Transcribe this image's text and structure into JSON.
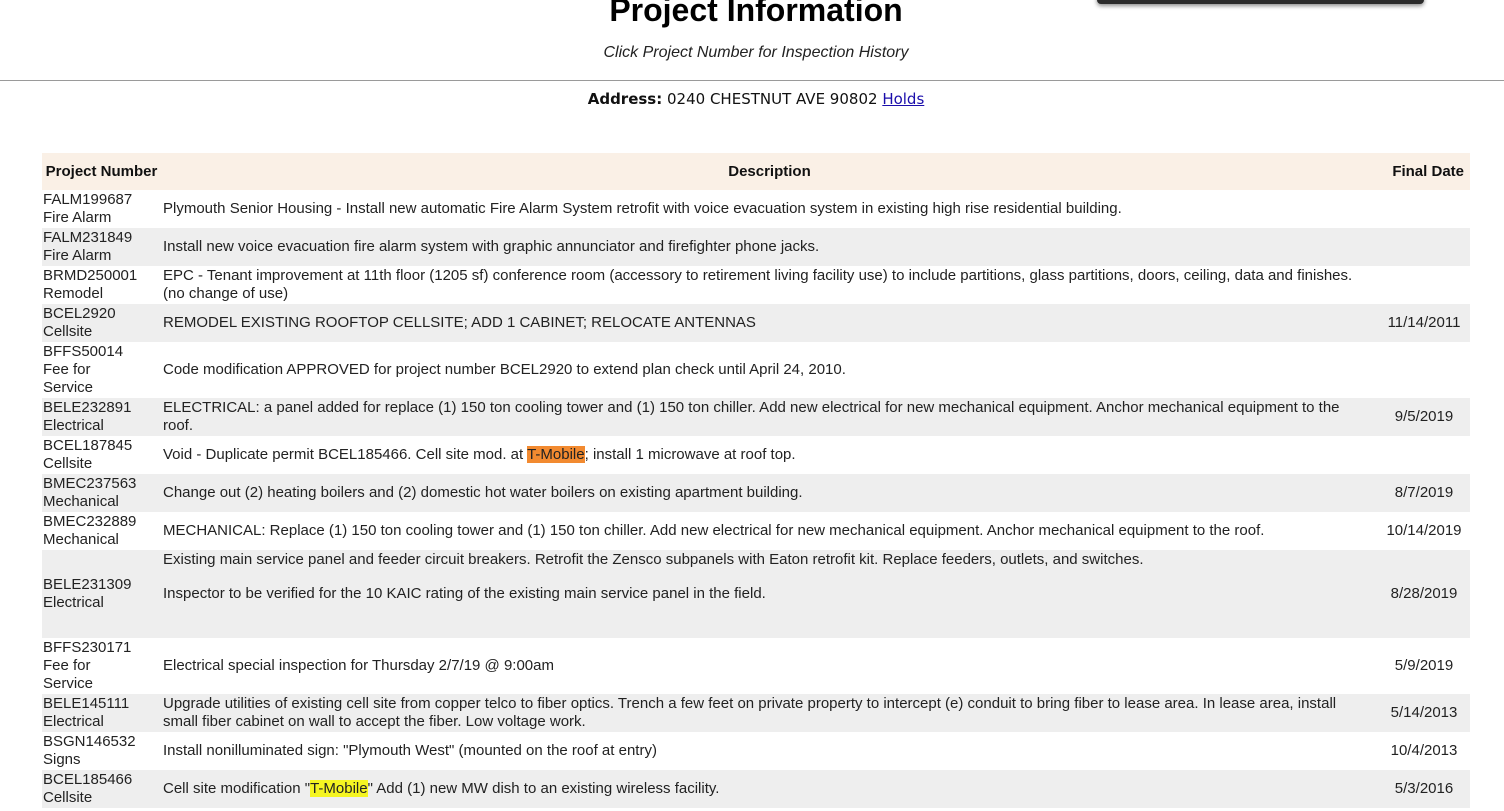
{
  "page": {
    "title": "Project Information",
    "subtitle": "Click Project Number for Inspection History",
    "address_label": "Address:",
    "address_value": "0240 CHESTNUT AVE 90802",
    "holds_link": "Holds"
  },
  "table": {
    "headers": {
      "number": "Project Number",
      "description": "Description",
      "final_date": "Final Date"
    },
    "rows": [
      {
        "id": "FALM199687",
        "type": "Fire Alarm",
        "description": "Plymouth Senior Housing - Install new automatic Fire Alarm System retrofit with voice evacuation system in existing high rise residential building.",
        "date": ""
      },
      {
        "id": "FALM231849",
        "type": "Fire Alarm",
        "description": "Install new voice evacuation fire alarm system with graphic annunciator and firefighter phone jacks.",
        "date": ""
      },
      {
        "id": "BRMD250001",
        "type": "Remodel",
        "description": "EPC - Tenant improvement at 11th floor (1205 sf) conference room (accessory to retirement living facility use) to include partitions, glass partitions, doors, ceiling, data and finishes. (no change of use)",
        "date": ""
      },
      {
        "id": "BCEL2920",
        "type": "Cellsite",
        "description": "REMODEL EXISTING ROOFTOP CELLSITE; ADD 1 CABINET; RELOCATE ANTENNAS",
        "date": "11/14/2011"
      },
      {
        "id": "BFFS50014",
        "type": "Fee for Service",
        "description": "Code modification APPROVED for project number BCEL2920 to extend plan check until April 24, 2010.",
        "date": ""
      },
      {
        "id": "BELE232891",
        "type": "Electrical",
        "description": "ELECTRICAL: a panel added for replace (1) 150 ton cooling tower and (1) 150 ton chiller. Add new electrical for new mechanical equipment. Anchor mechanical equipment to the roof.",
        "date": "9/5/2019"
      },
      {
        "id": "BCEL187845",
        "type": "Cellsite",
        "description_pre": "Void - Duplicate permit BCEL185466.  Cell site mod. at ",
        "highlight": "T-Mobile",
        "description_post": "; install 1 microwave at roof top.",
        "date": ""
      },
      {
        "id": "BMEC237563",
        "type": "Mechanical",
        "description": "Change out (2) heating boilers and (2) domestic hot water boilers on existing apartment building.",
        "date": "8/7/2019"
      },
      {
        "id": "BMEC232889",
        "type": "Mechanical",
        "description": "MECHANICAL: Replace (1) 150 ton cooling tower and (1) 150 ton chiller. Add new electrical for new mechanical equipment. Anchor mechanical equipment to the roof.",
        "date": "10/14/2019"
      },
      {
        "id": "BELE231309",
        "type": "Electrical",
        "description_line1": "Existing main service panel and feeder circuit breakers.  Retrofit the Zensco subpanels with Eaton retrofit kit.  Replace feeders, outlets, and switches.",
        "description_line2": "Inspector to be verified for the 10 KAIC rating of the existing main service panel in the field.",
        "date": "8/28/2019"
      },
      {
        "id": "BFFS230171",
        "type": "Fee for Service",
        "description": "Electrical special inspection for Thursday 2/7/19 @ 9:00am",
        "date": "5/9/2019"
      },
      {
        "id": "BELE145111",
        "type": "Electrical",
        "description": "Upgrade utilities of existing cell site from copper telco to fiber optics. Trench a few feet on private property to intercept (e) conduit to bring fiber to lease area. In lease area, install small fiber cabinet on wall to accept the fiber. Low voltage work.",
        "date": "5/14/2013"
      },
      {
        "id": "BSGN146532",
        "type": "Signs",
        "description": "Install nonilluminated sign:  \"Plymouth West\" (mounted on the roof at entry)",
        "date": "10/4/2013"
      },
      {
        "id": "BCEL185466",
        "type": "Cellsite",
        "description_pre": "Cell site modification \"",
        "highlight": "T-Mobile",
        "description_post": "\" Add (1) new MW dish to an existing wireless facility.",
        "date": "5/3/2016"
      }
    ]
  },
  "colors": {
    "header_bg": "#faf0e6",
    "row_alt_bg": "#eeeeee",
    "highlight_orange": "#f28a30",
    "highlight_yellow": "#f5f522",
    "link": "#1a0dab"
  }
}
